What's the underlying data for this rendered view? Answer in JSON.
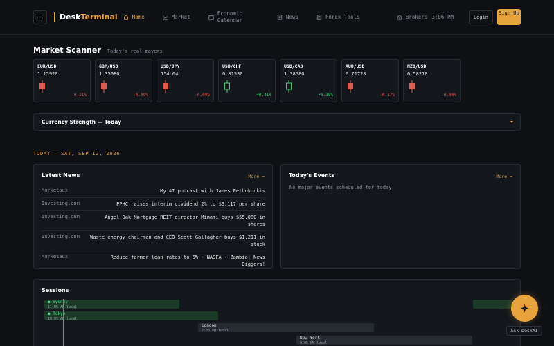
{
  "header": {
    "logo_primary": "Desk",
    "logo_secondary": "Terminal",
    "nav": [
      {
        "label": "Home",
        "icon": "home-icon",
        "active": true
      },
      {
        "label": "Market",
        "icon": "chart-icon"
      },
      {
        "label": "Economic Calendar",
        "icon": "calendar-icon"
      },
      {
        "label": "News",
        "icon": "newspaper-icon"
      },
      {
        "label": "Forex Tools",
        "icon": "calculator-icon"
      }
    ],
    "brokers_label": "Brokers",
    "clock": "3:06 PM",
    "login_label": "Login",
    "signup_label": "Sign Up"
  },
  "scanner": {
    "title": "Market Scanner",
    "subtitle": "Today's real movers",
    "pairs": [
      {
        "pair": "EUR/USD",
        "price": "1.15920",
        "change": "-0.21%",
        "direction": "down"
      },
      {
        "pair": "GBP/USD",
        "price": "1.35080",
        "change": "-0.09%",
        "direction": "down"
      },
      {
        "pair": "USD/JPY",
        "price": "154.04",
        "change": "-0.09%",
        "direction": "down"
      },
      {
        "pair": "USD/CHF",
        "price": "0.81530",
        "change": "+0.41%",
        "direction": "up"
      },
      {
        "pair": "USD/CAD",
        "price": "1.38580",
        "change": "+0.38%",
        "direction": "up"
      },
      {
        "pair": "AUD/USD",
        "price": "0.71728",
        "change": "-0.17%",
        "direction": "down"
      },
      {
        "pair": "NZD/USD",
        "price": "0.58210",
        "change": "-0.06%",
        "direction": "down"
      }
    ]
  },
  "strength": {
    "title": "Currency Strength — Today"
  },
  "today_label": "TODAY — SAT, SEP 12, 2026",
  "news": {
    "title": "Latest News",
    "more_label": "More →",
    "items": [
      {
        "source": "Marketaux",
        "headline": "My AI podcast with James Pethokoukis"
      },
      {
        "source": "Investing.com",
        "headline": "PPHC raises interim dividend 2% to $0.117 per share"
      },
      {
        "source": "Investing.com",
        "headline": "Angel Oak Mortgage REIT director Minami buys $55,080 in shares"
      },
      {
        "source": "Investing.com",
        "headline": "Waste energy chairman and CEO Scott Gallagher buys $1,211 in stock"
      },
      {
        "source": "Marketaux",
        "headline": "Reduce farmer loan rates to 5% - NASFA - Zambia: News Diggers!"
      }
    ]
  },
  "events": {
    "title": "Today's Events",
    "more_label": "More →",
    "empty_text": "No major events scheduled for today."
  },
  "sessions": {
    "title": "Sessions",
    "items": [
      {
        "name": "● Sydney",
        "local_time": "11:05 AM local",
        "state": "open"
      },
      {
        "name": "● Tokyo",
        "local_time": "10:05 AM local",
        "state": "open"
      },
      {
        "name": "London",
        "local_time": "2:05 AM local",
        "state": "closed"
      },
      {
        "name": "New York",
        "local_time": "9:05 PM local",
        "state": "closed"
      }
    ]
  },
  "ask": {
    "label": "Ask DeskAI",
    "icon": "sparkle-icon"
  },
  "colors": {
    "accent": "#e8a33c",
    "positive": "#3ecf6e",
    "negative": "#e05a4f",
    "background": "#0e1014"
  }
}
